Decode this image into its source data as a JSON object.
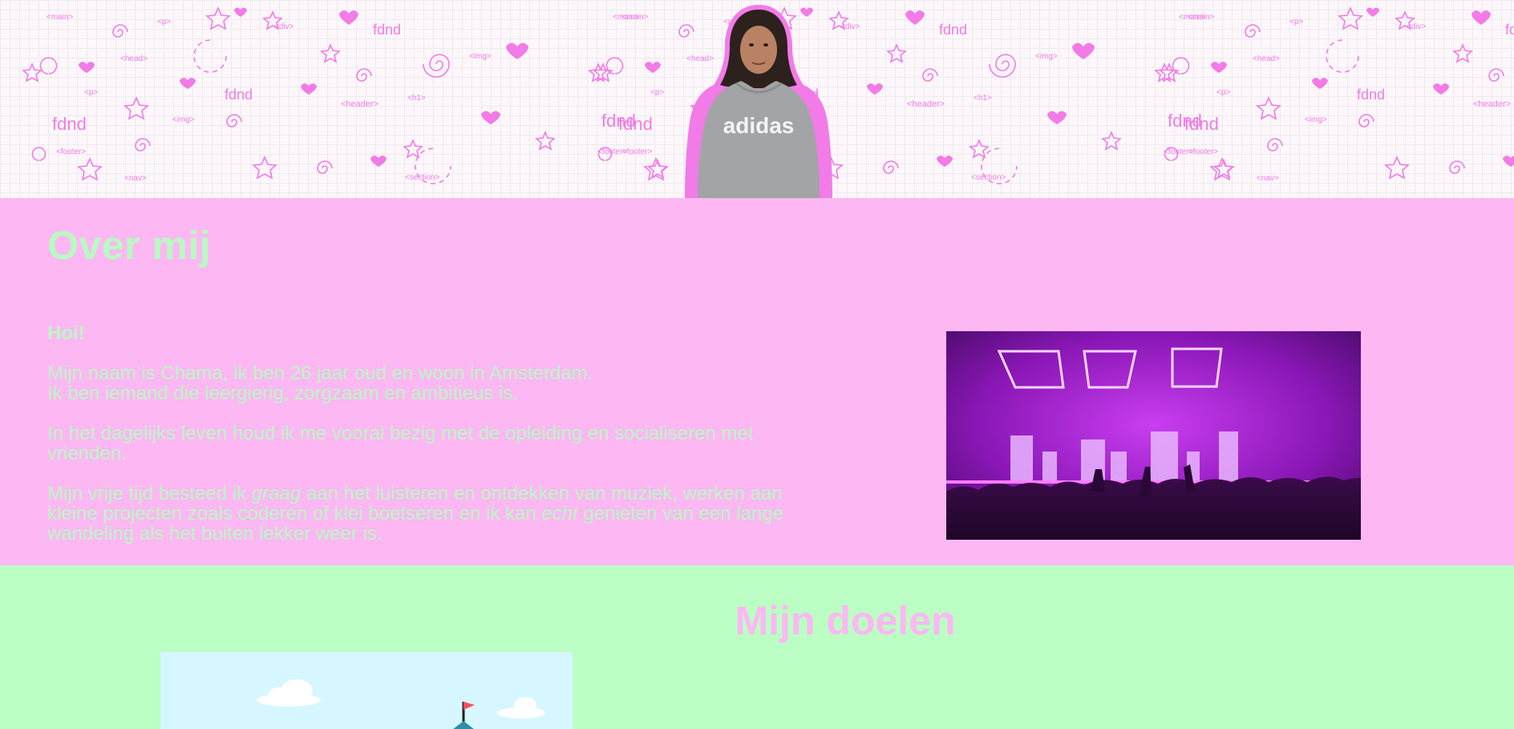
{
  "hero": {
    "doodle_words": [
      "<main>",
      "<p>",
      "<div>",
      "fdnd",
      "<head>",
      "<img>",
      "<header>",
      "<h1>",
      "<nav>",
      "<footer>",
      "<section>",
      "fdnd"
    ]
  },
  "about": {
    "title": "Over mij",
    "greeting": "Hoi!",
    "intro_line1": "Mijn naam is Chama, ik ben 26 jaar oud en woon in Amsterdam.",
    "intro_line2": "Ik ben iemand die leergierig, zorgzaam en ambitieus is.",
    "daily": "In het dagelijks leven houd ik me vooral bezig met de opleiding en socialiseren met vrienden.",
    "free_1": "Mijn vrije tijd besteed ik ",
    "free_em1": "graag",
    "free_2": " aan het luisteren en ontdekken van muziek, werken aan kleine projecten zoals coderen of klei boetseren en ik kan ",
    "free_em2": "echt",
    "free_3": " genieten van een lange wandeling als het buiten lekker weer is."
  },
  "goals": {
    "title": "Mijn doelen"
  },
  "colors": {
    "pink": "#fdb7f3",
    "mint": "#bbffc4",
    "doodle_pink": "#f27be8",
    "concert_purple": "#a01fc8"
  }
}
